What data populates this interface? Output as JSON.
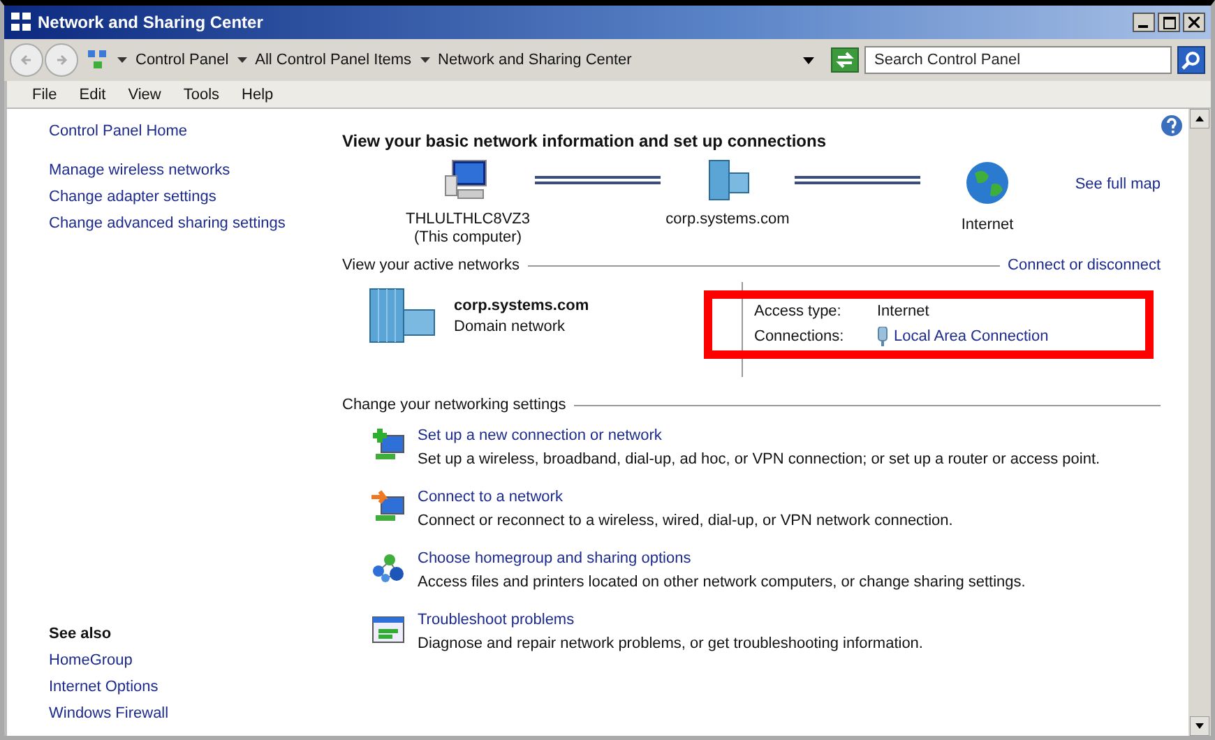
{
  "window": {
    "title": "Network and Sharing Center"
  },
  "address": {
    "crumbs": [
      "Control Panel",
      "All Control Panel Items",
      "Network and Sharing Center"
    ]
  },
  "search": {
    "placeholder": "Search Control Panel"
  },
  "menu": [
    "File",
    "Edit",
    "View",
    "Tools",
    "Help"
  ],
  "sidebar": {
    "home": "Control Panel Home",
    "links": [
      "Manage wireless networks",
      "Change adapter settings",
      "Change advanced sharing settings"
    ],
    "see_also_title": "See also",
    "see_also": [
      "HomeGroup",
      "Internet Options",
      "Windows Firewall"
    ]
  },
  "main": {
    "heading": "View your basic network information and set up connections",
    "map_nodes": [
      {
        "kind": "computer",
        "label": "THLULTHLC8VZ3",
        "sublabel": "(This computer)"
      },
      {
        "kind": "domain",
        "label": "corp.systems.com"
      },
      {
        "kind": "internet",
        "label": "Internet"
      }
    ],
    "see_full_map": "See full map",
    "active_title": "View your active networks",
    "connect_link": "Connect or disconnect",
    "network": {
      "name": "corp.systems.com",
      "type": "Domain network"
    },
    "details": {
      "highlighted": true,
      "access_label": "Access type:",
      "access_value": "Internet",
      "connections_label": "Connections:",
      "connection": "Local Area Connection"
    },
    "settings_title": "Change your networking settings",
    "tasks": [
      {
        "kind": "new",
        "title": "Set up a new connection or network",
        "description": "Set up a wireless, broadband, dial-up, ad hoc, or VPN connection; or set up a router or access point."
      },
      {
        "kind": "connect",
        "title": "Connect to a network",
        "description": "Connect or reconnect to a wireless, wired, dial-up, or VPN network connection."
      },
      {
        "kind": "homegroup",
        "title": "Choose homegroup and sharing options",
        "description": "Access files and printers located on other network computers, or change sharing settings."
      },
      {
        "kind": "troubleshoot",
        "title": "Troubleshoot problems",
        "description": "Diagnose and repair network problems, or get troubleshooting information."
      }
    ]
  }
}
